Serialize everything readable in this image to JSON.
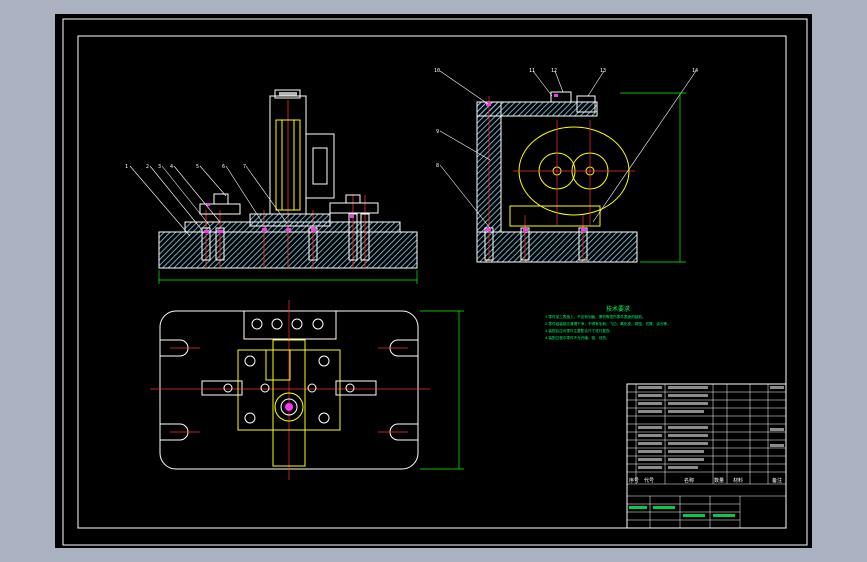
{
  "colors": {
    "window_bg": "#aab2c2",
    "canvas": "#000000",
    "frame": "#ffffff",
    "main_lines": "#ffffff",
    "hatch": "#7fd7f4",
    "center_lines": "#ff2f2f",
    "dimension": "#00ff00",
    "part": "#ffff00",
    "magenta": "#ff33ff",
    "notes": "#00ff66"
  },
  "balloons": {
    "front": [
      "1",
      "2",
      "3",
      "4",
      "5",
      "6",
      "7"
    ],
    "side": [
      "10",
      "9",
      "8",
      "11",
      "12",
      "13",
      "14"
    ]
  },
  "notes": {
    "title": "技术要求",
    "lines": [
      "1.零件加工表面上，不应有划痕、擦伤等损伤零件表面的缺陷。",
      "2.零件组装前应清理干净，不得有毛刺、飞边、氧化皮、锈蚀、切屑、油污等。",
      "3.装配后应对零件主要配合尺寸进行复查。",
      "4.装配过程中零件不允许磕、碰、划伤。"
    ]
  },
  "title_block": {
    "header": [
      "序号",
      "代号",
      "名称",
      "数量",
      "材料",
      "备注"
    ]
  }
}
